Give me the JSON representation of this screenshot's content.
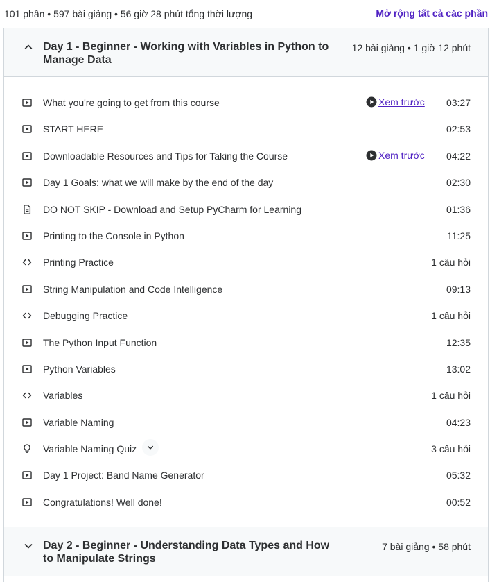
{
  "summary": "101 phần • 597 bài giảng • 56 giờ 28 phút tổng thời lượng",
  "expand_all": "Mở rộng tất cả các phần",
  "sections": [
    {
      "title": "Day 1 - Beginner - Working with Variables in Python to Manage Data",
      "meta": "12 bài giảng • 1 giờ 12 phút",
      "expanded": true
    },
    {
      "title": "Day 2 - Beginner - Understanding Data Types and How to Manipulate Strings",
      "meta": "7 bài giảng • 58 phút",
      "expanded": false
    }
  ],
  "preview_label": "Xem trước",
  "lectures": [
    {
      "icon": "video-icon",
      "name": "What you're going to get from this course",
      "duration": "03:27",
      "preview": true
    },
    {
      "icon": "video-icon",
      "name": "START HERE",
      "duration": "02:53",
      "preview": false
    },
    {
      "icon": "video-icon",
      "name": "Downloadable Resources and Tips for Taking the Course",
      "duration": "04:22",
      "preview": true
    },
    {
      "icon": "video-icon",
      "name": "Day 1 Goals: what we will make by the end of the day",
      "duration": "02:30",
      "preview": false
    },
    {
      "icon": "file-icon",
      "name": "DO NOT SKIP - Download and Setup PyCharm for Learning",
      "duration": "01:36",
      "preview": false
    },
    {
      "icon": "video-icon",
      "name": "Printing to the Console in Python",
      "duration": "11:25",
      "preview": false
    },
    {
      "icon": "code-icon",
      "name": "Printing Practice",
      "duration": "1 câu hỏi",
      "preview": false
    },
    {
      "icon": "video-icon",
      "name": "String Manipulation and Code Intelligence",
      "duration": "09:13",
      "preview": false
    },
    {
      "icon": "code-icon",
      "name": "Debugging Practice",
      "duration": "1 câu hỏi",
      "preview": false
    },
    {
      "icon": "video-icon",
      "name": "The Python Input Function",
      "duration": "12:35",
      "preview": false
    },
    {
      "icon": "video-icon",
      "name": "Python Variables",
      "duration": "13:02",
      "preview": false
    },
    {
      "icon": "code-icon",
      "name": "Variables",
      "duration": "1 câu hỏi",
      "preview": false
    },
    {
      "icon": "video-icon",
      "name": "Variable Naming",
      "duration": "04:23",
      "preview": false
    },
    {
      "icon": "quiz-icon",
      "name": "Variable Naming Quiz",
      "duration": "3 câu hỏi",
      "preview": false,
      "has_toggle": true
    },
    {
      "icon": "video-icon",
      "name": "Day 1 Project: Band Name Generator",
      "duration": "05:32",
      "preview": false
    },
    {
      "icon": "video-icon",
      "name": "Congratulations! Well done!",
      "duration": "00:52",
      "preview": false
    }
  ],
  "colors": {
    "text": "#2d2f31",
    "accent": "#5022c3",
    "border": "#d1d7dc",
    "header_bg": "#f7f9fa"
  }
}
